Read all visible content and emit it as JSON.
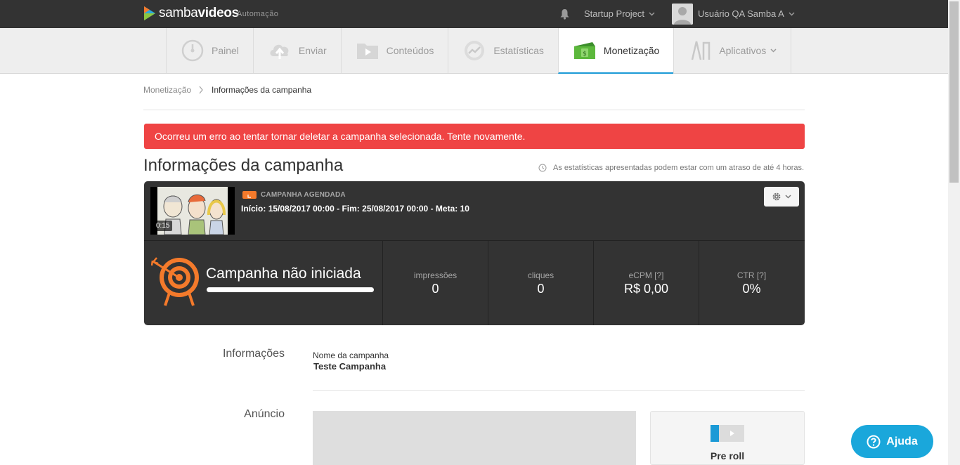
{
  "brand": {
    "name_light": "samba",
    "name_bold": "videos",
    "sub": "Automação"
  },
  "topbar": {
    "project": "Startup Project",
    "user": "Usuário QA Samba A"
  },
  "nav": {
    "items": [
      {
        "label": "Painel",
        "icon": "dashboard-icon"
      },
      {
        "label": "Enviar",
        "icon": "upload-cloud-icon"
      },
      {
        "label": "Conteúdos",
        "icon": "folder-icon"
      },
      {
        "label": "Estatísticas",
        "icon": "stats-icon"
      },
      {
        "label": "Monetização",
        "icon": "money-icon",
        "active": true
      },
      {
        "label": "Aplicativos",
        "icon": "apps-icon"
      }
    ]
  },
  "breadcrumb": {
    "parent": "Monetização",
    "current": "Informações da campanha"
  },
  "alert": {
    "message": "Ocorreu um erro ao tentar tornar deletar a campanha selecionada. Tente novamente."
  },
  "page": {
    "title": "Informações da campanha",
    "stats_note": "As estatísticas apresentadas podem estar com um atraso de até 4 horas."
  },
  "campaign": {
    "thumb_duration": "0:15",
    "status": "CAMPANHA AGENDADA",
    "start_label": "Início:",
    "start": "15/08/2017 00:00",
    "end_label": "Fim:",
    "end": "25/08/2017 00:00",
    "goal_label": "Meta:",
    "goal": "10",
    "state": "Campanha não iniciada",
    "progress": 0,
    "metrics": [
      {
        "label": "impressões",
        "value": "0"
      },
      {
        "label": "cliques",
        "value": "0"
      },
      {
        "label": "eCPM [?]",
        "value": "R$ 0,00"
      },
      {
        "label": "CTR [?]",
        "value": "0%"
      }
    ]
  },
  "info": {
    "section": "Informações",
    "name_label": "Nome da campanha",
    "name_value": "Teste Campanha"
  },
  "ad": {
    "section": "Anúncio",
    "type": "Pre roll"
  },
  "help": {
    "label": "Ajuda"
  },
  "colors": {
    "accent": "#1b9ad6",
    "alert": "#ef4444",
    "orange": "#f47a2b",
    "dark": "#333333"
  }
}
